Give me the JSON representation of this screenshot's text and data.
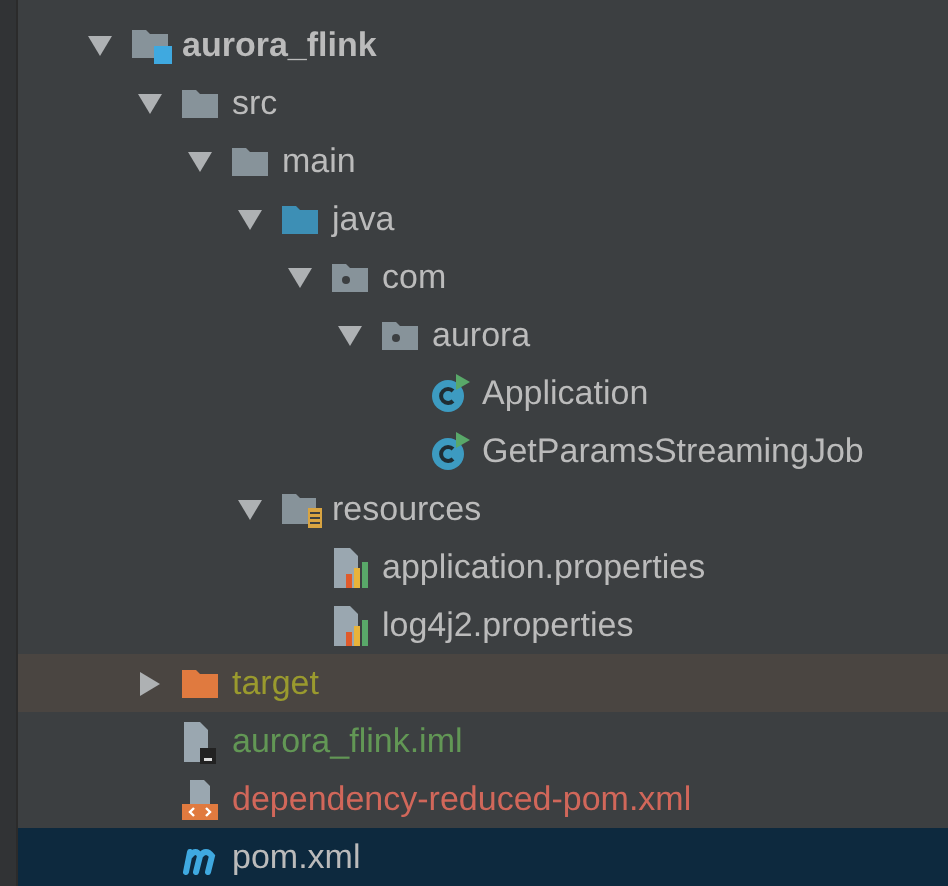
{
  "project_tree": [
    {
      "label": "aurora_flink",
      "kind": "module",
      "expanded": true,
      "selected": false,
      "highlighted": false,
      "color": "#bbbbbb",
      "children": [
        {
          "label": "src",
          "kind": "folder",
          "expanded": true,
          "selected": false,
          "highlighted": false,
          "color": "#bbbbbb",
          "children": [
            {
              "label": "main",
              "kind": "folder",
              "expanded": true,
              "selected": false,
              "highlighted": false,
              "color": "#bbbbbb",
              "children": [
                {
                  "label": "java",
                  "kind": "source_folder",
                  "expanded": true,
                  "selected": false,
                  "highlighted": false,
                  "color": "#bbbbbb",
                  "children": [
                    {
                      "label": "com",
                      "kind": "package",
                      "expanded": true,
                      "selected": false,
                      "highlighted": false,
                      "color": "#bbbbbb",
                      "children": [
                        {
                          "label": "aurora",
                          "kind": "package",
                          "expanded": true,
                          "selected": false,
                          "highlighted": false,
                          "color": "#bbbbbb",
                          "children": [
                            {
                              "label": "Application",
                              "kind": "runnable_class",
                              "selected": false,
                              "highlighted": false,
                              "color": "#bbbbbb"
                            },
                            {
                              "label": "GetParamsStreamingJob",
                              "kind": "runnable_class",
                              "selected": false,
                              "highlighted": false,
                              "color": "#bbbbbb"
                            }
                          ]
                        }
                      ]
                    }
                  ]
                },
                {
                  "label": "resources",
                  "kind": "resources_folder",
                  "expanded": true,
                  "selected": false,
                  "highlighted": false,
                  "color": "#bbbbbb",
                  "children": [
                    {
                      "label": "application.properties",
                      "kind": "properties",
                      "selected": false,
                      "highlighted": false,
                      "color": "#bbbbbb"
                    },
                    {
                      "label": "log4j2.properties",
                      "kind": "properties",
                      "selected": false,
                      "highlighted": false,
                      "color": "#bbbbbb"
                    }
                  ]
                }
              ]
            }
          ]
        },
        {
          "label": "target",
          "kind": "excluded_folder",
          "expanded": false,
          "selected": false,
          "highlighted": true,
          "color": "#9a9a2e"
        },
        {
          "label": "aurora_flink.iml",
          "kind": "iml",
          "selected": false,
          "highlighted": false,
          "color": "#629755"
        },
        {
          "label": "dependency-reduced-pom.xml",
          "kind": "xml",
          "selected": false,
          "highlighted": false,
          "color": "#d1675a"
        },
        {
          "label": "pom.xml",
          "kind": "maven",
          "selected": true,
          "highlighted": false,
          "color": "#bbbbbb"
        }
      ]
    }
  ]
}
